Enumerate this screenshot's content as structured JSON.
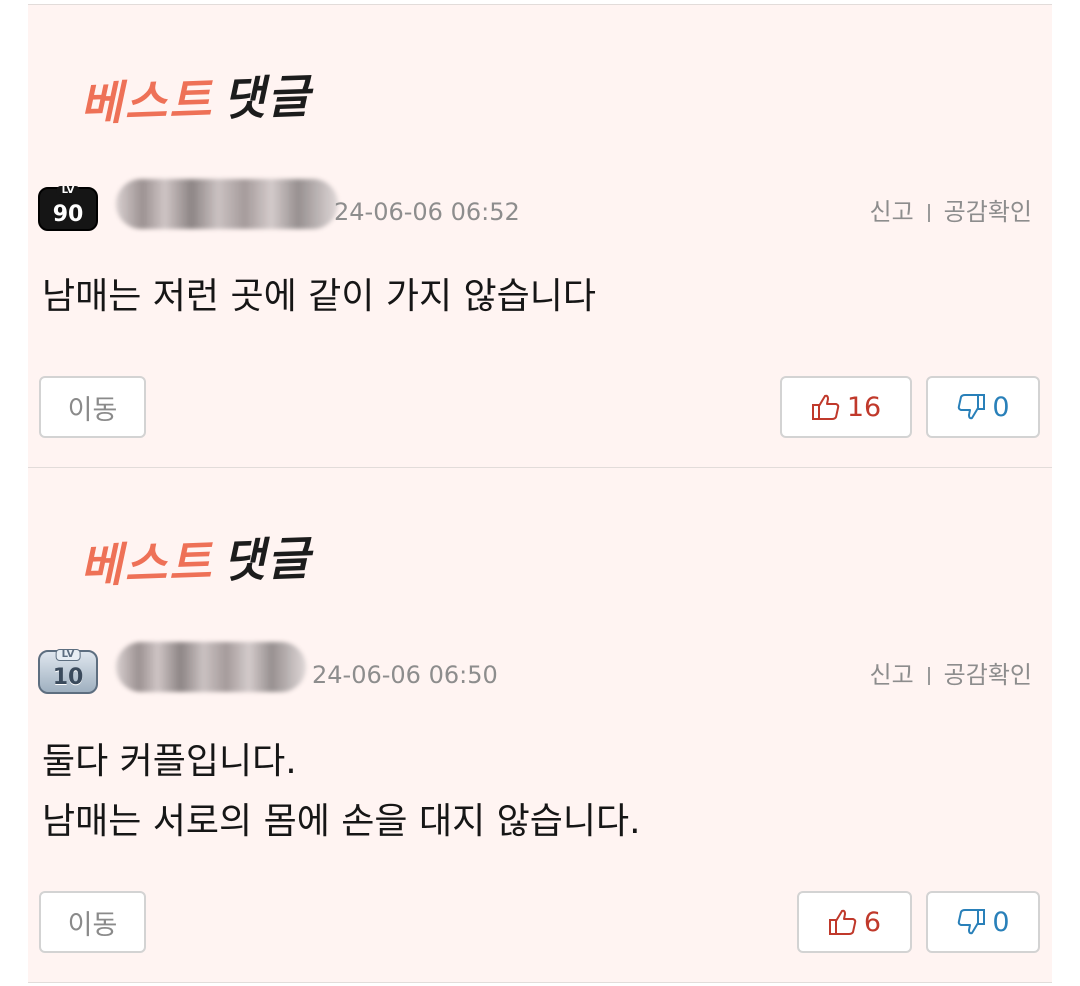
{
  "comments": [
    {
      "best_label_a": "베스트",
      "best_label_b": "댓글",
      "level": "90",
      "level_tag": "LV",
      "timestamp": "24-06-06 06:52",
      "report_label": "신고",
      "likes_label": "공감확인",
      "body": [
        "남매는 저런 곳에 같이 가지 않습니다"
      ],
      "move_label": "이동",
      "like_count": "16",
      "dislike_count": "0"
    },
    {
      "best_label_a": "베스트",
      "best_label_b": "댓글",
      "level": "10",
      "level_tag": "LV",
      "timestamp": "24-06-06 06:50",
      "report_label": "신고",
      "likes_label": "공감확인",
      "body": [
        "둘다 커플입니다.",
        "남매는 서로의 몸에 손을 대지 않습니다."
      ],
      "move_label": "이동",
      "like_count": "6",
      "dislike_count": "0"
    }
  ],
  "colors": {
    "card_bg": "#fff4f2",
    "best_accent": "#ee7157",
    "like": "#c0392b",
    "dislike": "#2980b9",
    "muted_text": "#8d8d8d"
  },
  "icons": {
    "like": "thumbs-up-icon",
    "dislike": "thumbs-down-icon"
  }
}
